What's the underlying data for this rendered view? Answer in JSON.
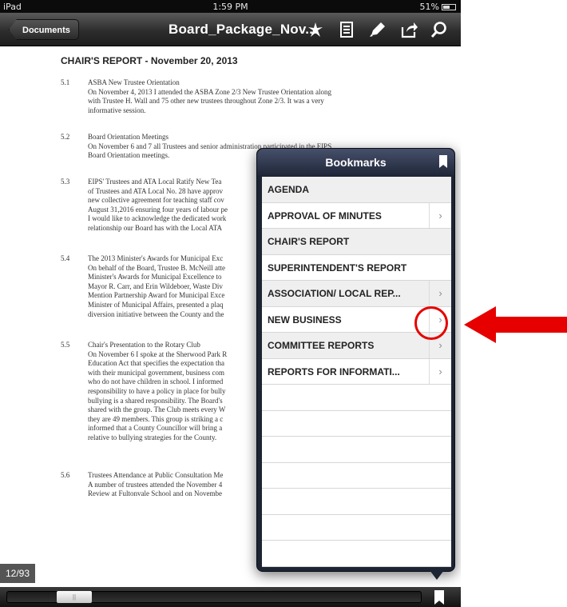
{
  "status_bar": {
    "device": "iPad",
    "time": "1:59 PM",
    "battery": "51%"
  },
  "toolbar": {
    "back_label": "Documents",
    "title": "Board_Package_Nov...",
    "icons": [
      "annotate-icon",
      "thumbnails-icon",
      "pen-icon",
      "share-icon",
      "search-icon"
    ]
  },
  "document": {
    "heading": "CHAIR'S REPORT - November 20, 2013",
    "sections": [
      {
        "num": "5.1",
        "lines": [
          "ASBA New Trustee Orientation",
          "On November 4, 2013 I attended the ASBA Zone 2/3 New Trustee Orientation along",
          "with Trustee H. Wall and 75 other new trustees throughout Zone 2/3. It was a very",
          "informative session."
        ]
      },
      {
        "num": "5.2",
        "lines": [
          "Board Orientation Meetings",
          "On November 6 and 7 all Trustees and senior administration participated in the EIPS",
          "Board Orientation meetings."
        ]
      },
      {
        "num": "5.3",
        "lines": [
          "EIPS' Trustees and ATA Local Ratify New Tea",
          "of Trustees and ATA Local No. 28 have approv",
          "new collective agreement for teaching staff cov",
          "August 31,2016 ensuring four years of labour pe",
          "I would like to acknowledge the dedicated work",
          "relationship our Board has with the Local ATA"
        ]
      },
      {
        "num": "5.4",
        "lines": [
          "The 2013 Minister's Awards for Municipal Exc",
          "On behalf of the Board, Trustee B. McNeill atte",
          "Minister's Awards for Municipal Excellence to",
          "Mayor R. Carr, and Erin Wildeboer, Waste Div",
          "Mention Partnership Award for Municipal Exce",
          "Minister of Municipal Affairs, presented a plaq",
          "diversion initiative between the County and the"
        ]
      },
      {
        "num": "5.5",
        "lines": [
          "Chair's Presentation to the Rotary Club",
          "On November 6 I spoke at the Sherwood Park R",
          "Education Act that specifies the expectation tha",
          "with their municipal government, business com",
          "who do not have children in school. I informed",
          "responsibility to have a policy in place for bully",
          "bullying is a shared responsibility. The Board's",
          "shared with the group. The Club meets every W",
          "they are 49 members. This group is striking a c",
          "informed that a County Councillor will bring a",
          "relative to bullying strategies for the County."
        ]
      },
      {
        "num": "5.6",
        "lines": [
          "Trustees Attendance at Public Consultation Me",
          "A number of trustees attended the November 4",
          "Review at Fultonvale School and on Novembe"
        ]
      }
    ]
  },
  "page_indicator": "12/93",
  "bookmarks": {
    "title": "Bookmarks",
    "items": [
      {
        "label": "AGENDA",
        "has_children": false,
        "shaded": true
      },
      {
        "label": "APPROVAL OF MINUTES",
        "has_children": true,
        "shaded": false
      },
      {
        "label": "CHAIR'S REPORT",
        "has_children": false,
        "shaded": true
      },
      {
        "label": "SUPERINTENDENT'S REPORT",
        "has_children": false,
        "shaded": false
      },
      {
        "label": "ASSOCIATION/ LOCAL REP...",
        "has_children": true,
        "shaded": true
      },
      {
        "label": "NEW BUSINESS",
        "has_children": true,
        "shaded": false
      },
      {
        "label": "COMMITTEE REPORTS",
        "has_children": true,
        "shaded": true
      },
      {
        "label": "REPORTS FOR INFORMATI...",
        "has_children": true,
        "shaded": false
      }
    ],
    "empty_rows": 7
  },
  "scrubber": {
    "thumb_glyph": "||"
  },
  "annotation": {
    "color": "#e60000"
  }
}
